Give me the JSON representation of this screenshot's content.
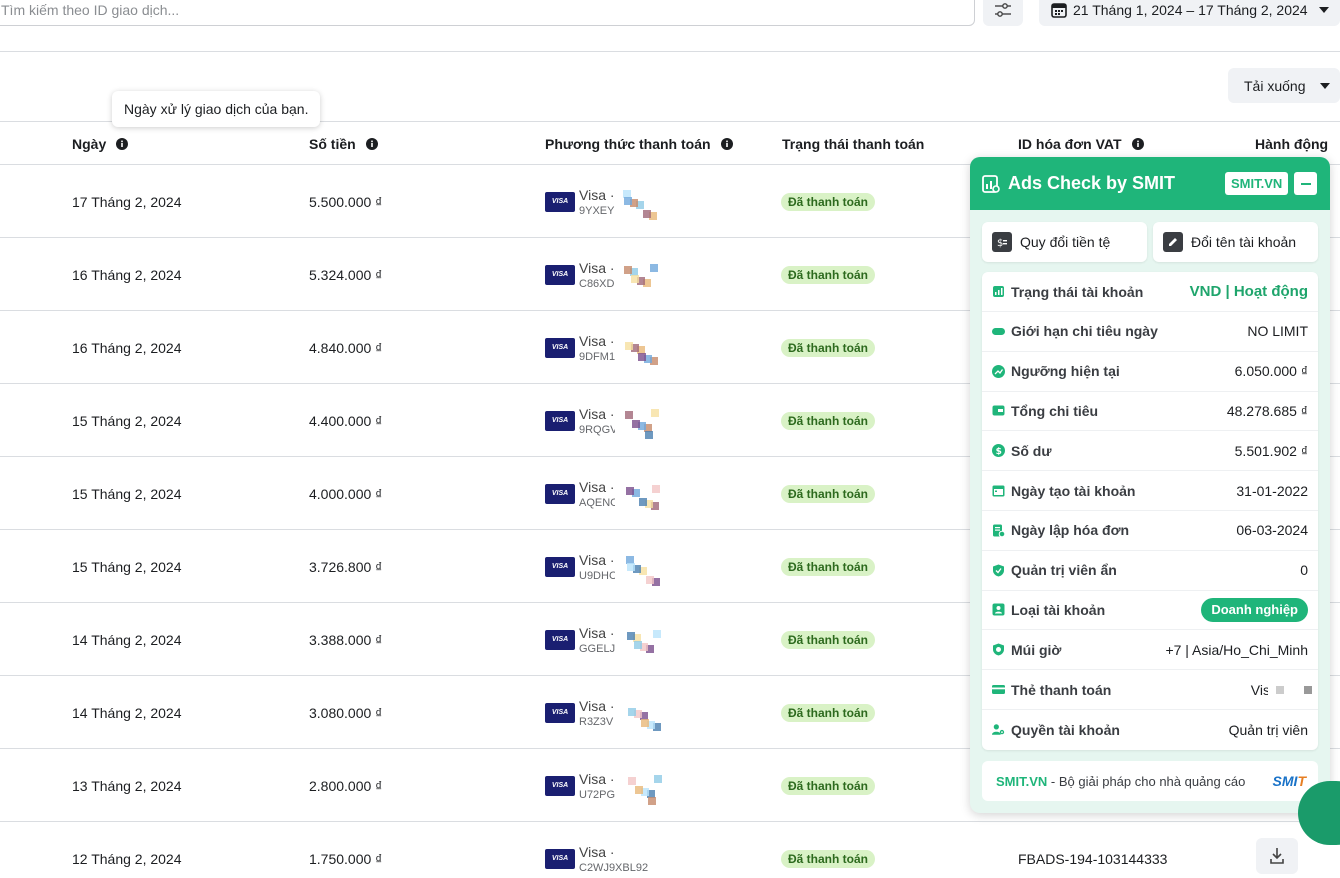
{
  "search": {
    "placeholder": "Tìm kiếm theo ID giao dịch..."
  },
  "date_range": {
    "label": "21 Tháng 1, 2024 – 17 Tháng 2, 2024"
  },
  "download": {
    "label": "Tải xuống"
  },
  "tooltip": {
    "text": "Ngày xử lý giao dịch của bạn."
  },
  "table": {
    "headers": {
      "date": "Ngày",
      "amount": "Số tiền",
      "method": "Phương thức thanh toán",
      "status": "Trạng thái thanh toán",
      "vat": "ID hóa đơn VAT",
      "action": "Hành động"
    },
    "rows": [
      {
        "date": "17 Tháng 2, 2024",
        "amount": "5.500.000 ₫",
        "card": "Visa ·",
        "code": "9YXEY",
        "status": "Đã thanh toán"
      },
      {
        "date": "16 Tháng 2, 2024",
        "amount": "5.324.000 ₫",
        "card": "Visa ·",
        "code": "C86XD",
        "status": "Đã thanh toán"
      },
      {
        "date": "16 Tháng 2, 2024",
        "amount": "4.840.000 ₫",
        "card": "Visa ·",
        "code": "9DFM1",
        "status": "Đã thanh toán"
      },
      {
        "date": "15 Tháng 2, 2024",
        "amount": "4.400.000 ₫",
        "card": "Visa ·",
        "code": "9RQGV",
        "status": "Đã thanh toán"
      },
      {
        "date": "15 Tháng 2, 2024",
        "amount": "4.000.000 ₫",
        "card": "Visa ·",
        "code": "AQENC",
        "status": "Đã thanh toán"
      },
      {
        "date": "15 Tháng 2, 2024",
        "amount": "3.726.800 ₫",
        "card": "Visa ·",
        "code": "U9DHC",
        "status": "Đã thanh toán"
      },
      {
        "date": "14 Tháng 2, 2024",
        "amount": "3.388.000 ₫",
        "card": "Visa ·",
        "code": "GGELJ",
        "status": "Đã thanh toán"
      },
      {
        "date": "14 Tháng 2, 2024",
        "amount": "3.080.000 ₫",
        "card": "Visa ·",
        "code": "R3Z3V",
        "status": "Đã thanh toán"
      },
      {
        "date": "13 Tháng 2, 2024",
        "amount": "2.800.000 ₫",
        "card": "Visa ·",
        "code": "U72PG",
        "status": "Đã thanh toán"
      },
      {
        "date": "12 Tháng 2, 2024",
        "amount": "1.750.000 ₫",
        "card": "Visa ·",
        "code": "C2WJ9XBL92",
        "status": "Đã thanh toán",
        "vat": "FBADS-194-103144333"
      }
    ]
  },
  "widget": {
    "title": "Ads Check by SMIT",
    "badge": "SMIT.VN",
    "actions": {
      "convert": "Quy đổi tiền tệ",
      "rename": "Đổi tên tài khoản"
    },
    "items": [
      {
        "label": "Trạng thái tài khoản",
        "value": "VND | Hoạt động",
        "icon": "bar-chart-icon"
      },
      {
        "label": "Giới hạn chi tiêu ngày",
        "value": "NO LIMIT",
        "icon": "limit-icon"
      },
      {
        "label": "Ngưỡng hiện tại",
        "value": "6.050.000 ₫",
        "icon": "trend-icon"
      },
      {
        "label": "Tổng chi tiêu",
        "value": "48.278.685 ₫",
        "icon": "wallet-icon"
      },
      {
        "label": "Số dư",
        "value": "5.501.902 ₫",
        "icon": "dollar-icon"
      },
      {
        "label": "Ngày tạo tài khoản",
        "value": "31-01-2022",
        "icon": "calendar-icon"
      },
      {
        "label": "Ngày lập hóa đơn",
        "value": "06-03-2024",
        "icon": "invoice-icon"
      },
      {
        "label": "Quản trị viên ẩn",
        "value": "0",
        "icon": "shield-icon"
      },
      {
        "label": "Loại tài khoản",
        "value": "Doanh nghiệp",
        "icon": "user-card-icon"
      },
      {
        "label": "Múi giờ",
        "value": "+7 | Asia/Ho_Chi_Minh",
        "icon": "timezone-icon"
      },
      {
        "label": "Thẻ thanh toán",
        "value": "Vis",
        "icon": "card-icon"
      },
      {
        "label": "Quyền tài khoản",
        "value": "Quản trị viên",
        "icon": "user-gear-icon"
      }
    ],
    "footer": {
      "brand": "SMIT.VN",
      "text": " - Bộ giải pháp cho nhà quảng cáo",
      "logo_main": "SMI",
      "logo_accent": "T"
    }
  },
  "colors": {
    "accent": "#1fb57a",
    "badge_bg": "#d9f2c6",
    "visa": "#1a1f71"
  }
}
